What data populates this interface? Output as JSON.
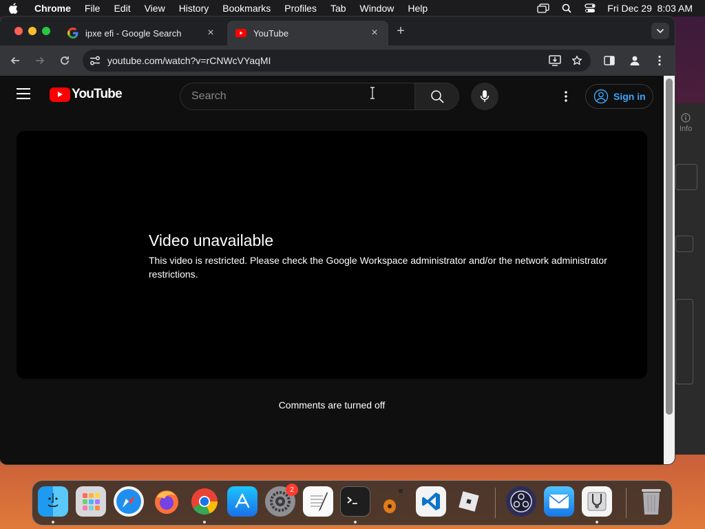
{
  "menubar": {
    "app": "Chrome",
    "menus": [
      "File",
      "Edit",
      "View",
      "History",
      "Bookmarks",
      "Profiles",
      "Tab",
      "Window",
      "Help"
    ],
    "datetime": "Fri Dec 29  8:03 AM"
  },
  "tabs": [
    {
      "title": "ipxe efi - Google Search",
      "icon": "google-icon",
      "active": false
    },
    {
      "title": "YouTube",
      "icon": "youtube-icon",
      "active": true
    }
  ],
  "toolbar": {
    "url": "youtube.com/watch?v=rCNWcVYaqMI"
  },
  "youtube": {
    "logo_text": "YouTube",
    "search_placeholder": "Search",
    "sign_in": "Sign in",
    "error_title": "Video unavailable",
    "error_message": "This video is restricted. Please check the Google Workspace administrator and/or the network administrator restrictions.",
    "comments_status": "Comments are turned off"
  },
  "background_window": {
    "info_label": "Info"
  },
  "dock": {
    "apps": [
      "finder",
      "launchpad",
      "safari",
      "firefox",
      "chrome",
      "app-store",
      "system-settings",
      "textedit",
      "terminal",
      "garageband",
      "vscode",
      "roblox",
      "obs",
      "mail",
      "disk-utility",
      "trash"
    ],
    "settings_badge": "2"
  },
  "colors": {
    "youtube_red": "#ff0000",
    "link_blue": "#3ea6ff",
    "page_bg": "#0f0f0f"
  }
}
